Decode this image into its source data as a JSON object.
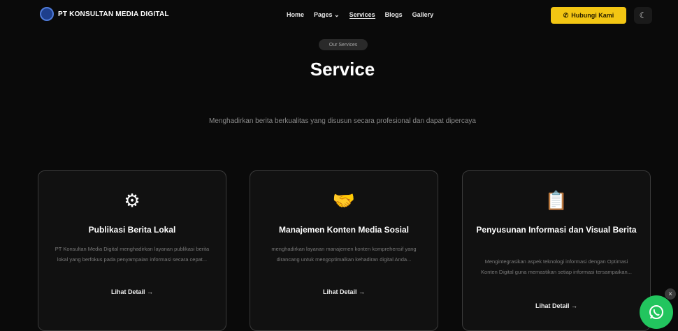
{
  "header": {
    "brand": "PT KONSULTAN MEDIA DIGITAL",
    "nav": [
      "Home",
      "Pages ⌄",
      "Services",
      "Blogs",
      "Gallery"
    ],
    "active_nav": "Services",
    "cta_label": "Hubungi Kami",
    "theme_icon": "moon-icon"
  },
  "hero": {
    "pill": "Our Services",
    "title": "Service",
    "subtitle": "Menghadirkan berita berkualitas yang disusun secara profesional dan dapat dipercaya"
  },
  "cards": [
    {
      "icon": "gear-calendar-icon",
      "title": "Publikasi Berita Lokal",
      "description": "PT Konsultan Media Digital menghadirkan layanan publikasi berita lokal yang berfokus pada penyampaian informasi secara cepat...",
      "link": "Lihat Detail →"
    },
    {
      "icon": "handshake-icon",
      "title": "Manajemen Konten Media Sosial",
      "description": "menghadirkan layanan manajemen konten komprehensif yang dirancang untuk mengoptimalkan kehadiran digital Anda...",
      "link": "Lihat Detail →"
    },
    {
      "icon": "document-camera-icon",
      "title": "Penyusunan Informasi dan Visual Berita",
      "description": "Mengintegrasikan aspek teknologi informasi dengan Optimasi Konten Digital guna memastikan setiap informasi tersampaikan...",
      "link": "Lihat Detail →"
    }
  ],
  "floating": {
    "close": "×",
    "whatsapp_icon": "whatsapp-icon"
  },
  "colors": {
    "background": "#0a0a0a",
    "cta": "#f3c613",
    "whatsapp": "#22c55e"
  }
}
